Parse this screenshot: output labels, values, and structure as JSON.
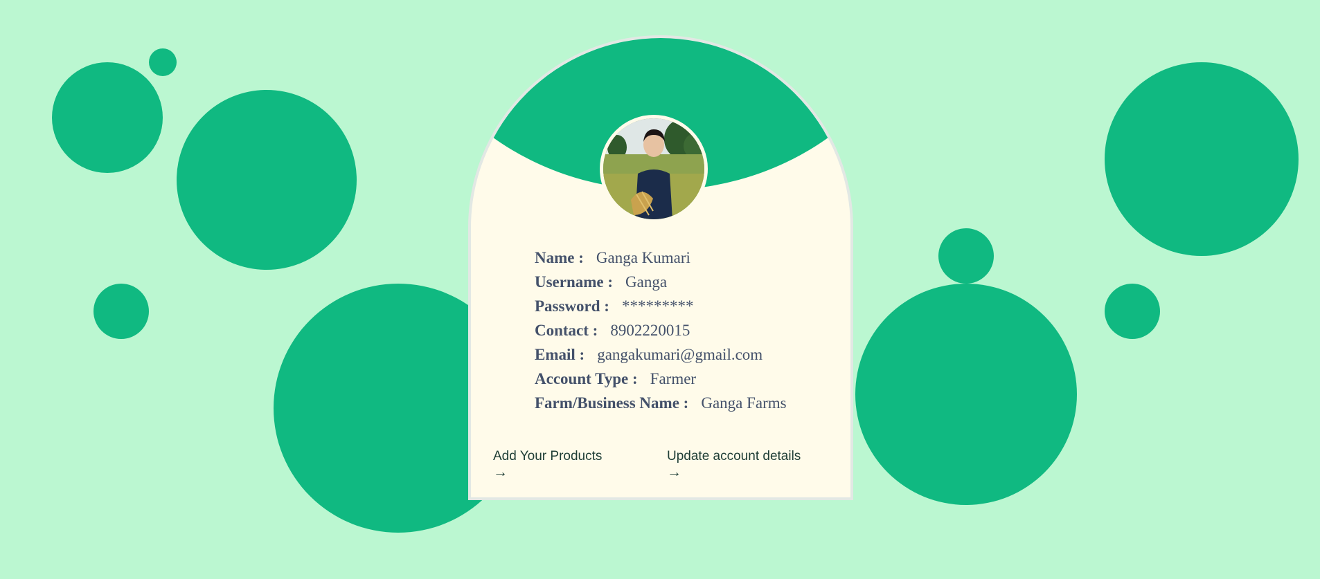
{
  "profile": {
    "avatar_alt": "profile photo",
    "fields": [
      {
        "label": "Name :",
        "value": "Ganga Kumari"
      },
      {
        "label": "Username :",
        "value": "Ganga"
      },
      {
        "label": "Password :",
        "value": "*********"
      },
      {
        "label": "Contact :",
        "value": "8902220015"
      },
      {
        "label": "Email :",
        "value": "gangakumari@gmail.com"
      },
      {
        "label": "Account Type :",
        "value": "Farmer"
      },
      {
        "label": "Farm/Business Name :",
        "value": "Ganga Farms"
      }
    ]
  },
  "actions": {
    "add_products": {
      "label": "Add Your Products",
      "icon": "→"
    },
    "update_account": {
      "label": "Update account details",
      "icon": "→"
    }
  },
  "colors": {
    "background": "#bbf7d1",
    "accent": "#10b981",
    "card": "#fffbea",
    "text": "#44516a"
  }
}
